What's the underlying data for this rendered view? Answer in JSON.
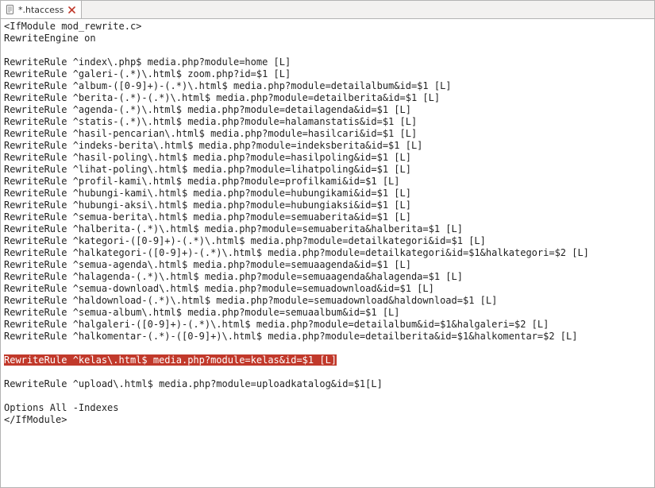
{
  "tab": {
    "filename": "*.htaccess"
  },
  "file": {
    "lines": [
      "<IfModule mod_rewrite.c>",
      "RewriteEngine on",
      "",
      "RewriteRule ^index\\.php$ media.php?module=home [L]",
      "RewriteRule ^galeri-(.*)\\.html$ zoom.php?id=$1 [L]",
      "RewriteRule ^album-([0-9]+)-(.*)\\.html$ media.php?module=detailalbum&id=$1 [L]",
      "RewriteRule ^berita-(.*)-(.*)\\.html$ media.php?module=detailberita&id=$1 [L]",
      "RewriteRule ^agenda-(.*)\\.html$ media.php?module=detailagenda&id=$1 [L]",
      "RewriteRule ^statis-(.*)\\.html$ media.php?module=halamanstatis&id=$1 [L]",
      "RewriteRule ^hasil-pencarian\\.html$ media.php?module=hasilcari&id=$1 [L]",
      "RewriteRule ^indeks-berita\\.html$ media.php?module=indeksberita&id=$1 [L]",
      "RewriteRule ^hasil-poling\\.html$ media.php?module=hasilpoling&id=$1 [L]",
      "RewriteRule ^lihat-poling\\.html$ media.php?module=lihatpoling&id=$1 [L]",
      "RewriteRule ^profil-kami\\.html$ media.php?module=profilkami&id=$1 [L]",
      "RewriteRule ^hubungi-kami\\.html$ media.php?module=hubungikami&id=$1 [L]",
      "RewriteRule ^hubungi-aksi\\.html$ media.php?module=hubungiaksi&id=$1 [L]",
      "RewriteRule ^semua-berita\\.html$ media.php?module=semuaberita&id=$1 [L]",
      "RewriteRule ^halberita-(.*)\\.html$ media.php?module=semuaberita&halberita=$1 [L]",
      "RewriteRule ^kategori-([0-9]+)-(.*)\\.html$ media.php?module=detailkategori&id=$1 [L]",
      "RewriteRule ^halkategori-([0-9]+)-(.*)\\.html$ media.php?module=detailkategori&id=$1&halkategori=$2 [L]",
      "RewriteRule ^semua-agenda\\.html$ media.php?module=semuaagenda&id=$1 [L]",
      "RewriteRule ^halagenda-(.*)\\.html$ media.php?module=semuaagenda&halagenda=$1 [L]",
      "RewriteRule ^semua-download\\.html$ media.php?module=semuadownload&id=$1 [L]",
      "RewriteRule ^haldownload-(.*)\\.html$ media.php?module=semuadownload&haldownload=$1 [L]",
      "RewriteRule ^semua-album\\.html$ media.php?module=semuaalbum&id=$1 [L]",
      "RewriteRule ^halgaleri-([0-9]+)-(.*)\\.html$ media.php?module=detailalbum&id=$1&halgaleri=$2 [L]",
      "RewriteRule ^halkomentar-(.*)-([0-9]+)\\.html$ media.php?module=detailberita&id=$1&halkomentar=$2 [L]",
      "",
      "",
      "",
      "RewriteRule ^upload\\.html$ media.php?module=uploadkatalog&id=$1[L]",
      "",
      "Options All -Indexes",
      "</IfModule>"
    ],
    "highlighted_line_index": 28,
    "highlighted_line": "RewriteRule ^kelas\\.html$ media.php?module=kelas&id=$1 [L]"
  }
}
